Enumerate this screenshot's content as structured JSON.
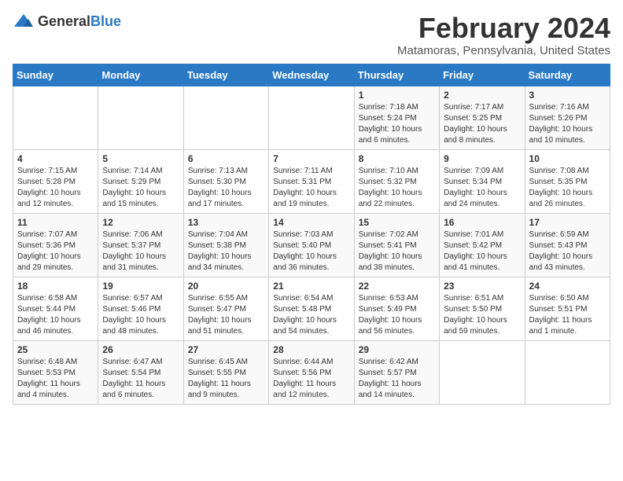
{
  "logo": {
    "text_general": "General",
    "text_blue": "Blue"
  },
  "title": "February 2024",
  "subtitle": "Matamoras, Pennsylvania, United States",
  "days_header": [
    "Sunday",
    "Monday",
    "Tuesday",
    "Wednesday",
    "Thursday",
    "Friday",
    "Saturday"
  ],
  "weeks": [
    [
      {
        "day": "",
        "info": ""
      },
      {
        "day": "",
        "info": ""
      },
      {
        "day": "",
        "info": ""
      },
      {
        "day": "",
        "info": ""
      },
      {
        "day": "1",
        "info": "Sunrise: 7:18 AM\nSunset: 5:24 PM\nDaylight: 10 hours\nand 6 minutes."
      },
      {
        "day": "2",
        "info": "Sunrise: 7:17 AM\nSunset: 5:25 PM\nDaylight: 10 hours\nand 8 minutes."
      },
      {
        "day": "3",
        "info": "Sunrise: 7:16 AM\nSunset: 5:26 PM\nDaylight: 10 hours\nand 10 minutes."
      }
    ],
    [
      {
        "day": "4",
        "info": "Sunrise: 7:15 AM\nSunset: 5:28 PM\nDaylight: 10 hours\nand 12 minutes."
      },
      {
        "day": "5",
        "info": "Sunrise: 7:14 AM\nSunset: 5:29 PM\nDaylight: 10 hours\nand 15 minutes."
      },
      {
        "day": "6",
        "info": "Sunrise: 7:13 AM\nSunset: 5:30 PM\nDaylight: 10 hours\nand 17 minutes."
      },
      {
        "day": "7",
        "info": "Sunrise: 7:11 AM\nSunset: 5:31 PM\nDaylight: 10 hours\nand 19 minutes."
      },
      {
        "day": "8",
        "info": "Sunrise: 7:10 AM\nSunset: 5:32 PM\nDaylight: 10 hours\nand 22 minutes."
      },
      {
        "day": "9",
        "info": "Sunrise: 7:09 AM\nSunset: 5:34 PM\nDaylight: 10 hours\nand 24 minutes."
      },
      {
        "day": "10",
        "info": "Sunrise: 7:08 AM\nSunset: 5:35 PM\nDaylight: 10 hours\nand 26 minutes."
      }
    ],
    [
      {
        "day": "11",
        "info": "Sunrise: 7:07 AM\nSunset: 5:36 PM\nDaylight: 10 hours\nand 29 minutes."
      },
      {
        "day": "12",
        "info": "Sunrise: 7:06 AM\nSunset: 5:37 PM\nDaylight: 10 hours\nand 31 minutes."
      },
      {
        "day": "13",
        "info": "Sunrise: 7:04 AM\nSunset: 5:38 PM\nDaylight: 10 hours\nand 34 minutes."
      },
      {
        "day": "14",
        "info": "Sunrise: 7:03 AM\nSunset: 5:40 PM\nDaylight: 10 hours\nand 36 minutes."
      },
      {
        "day": "15",
        "info": "Sunrise: 7:02 AM\nSunset: 5:41 PM\nDaylight: 10 hours\nand 38 minutes."
      },
      {
        "day": "16",
        "info": "Sunrise: 7:01 AM\nSunset: 5:42 PM\nDaylight: 10 hours\nand 41 minutes."
      },
      {
        "day": "17",
        "info": "Sunrise: 6:59 AM\nSunset: 5:43 PM\nDaylight: 10 hours\nand 43 minutes."
      }
    ],
    [
      {
        "day": "18",
        "info": "Sunrise: 6:58 AM\nSunset: 5:44 PM\nDaylight: 10 hours\nand 46 minutes."
      },
      {
        "day": "19",
        "info": "Sunrise: 6:57 AM\nSunset: 5:46 PM\nDaylight: 10 hours\nand 48 minutes."
      },
      {
        "day": "20",
        "info": "Sunrise: 6:55 AM\nSunset: 5:47 PM\nDaylight: 10 hours\nand 51 minutes."
      },
      {
        "day": "21",
        "info": "Sunrise: 6:54 AM\nSunset: 5:48 PM\nDaylight: 10 hours\nand 54 minutes."
      },
      {
        "day": "22",
        "info": "Sunrise: 6:53 AM\nSunset: 5:49 PM\nDaylight: 10 hours\nand 56 minutes."
      },
      {
        "day": "23",
        "info": "Sunrise: 6:51 AM\nSunset: 5:50 PM\nDaylight: 10 hours\nand 59 minutes."
      },
      {
        "day": "24",
        "info": "Sunrise: 6:50 AM\nSunset: 5:51 PM\nDaylight: 11 hours\nand 1 minute."
      }
    ],
    [
      {
        "day": "25",
        "info": "Sunrise: 6:48 AM\nSunset: 5:53 PM\nDaylight: 11 hours\nand 4 minutes."
      },
      {
        "day": "26",
        "info": "Sunrise: 6:47 AM\nSunset: 5:54 PM\nDaylight: 11 hours\nand 6 minutes."
      },
      {
        "day": "27",
        "info": "Sunrise: 6:45 AM\nSunset: 5:55 PM\nDaylight: 11 hours\nand 9 minutes."
      },
      {
        "day": "28",
        "info": "Sunrise: 6:44 AM\nSunset: 5:56 PM\nDaylight: 11 hours\nand 12 minutes."
      },
      {
        "day": "29",
        "info": "Sunrise: 6:42 AM\nSunset: 5:57 PM\nDaylight: 11 hours\nand 14 minutes."
      },
      {
        "day": "",
        "info": ""
      },
      {
        "day": "",
        "info": ""
      }
    ]
  ]
}
